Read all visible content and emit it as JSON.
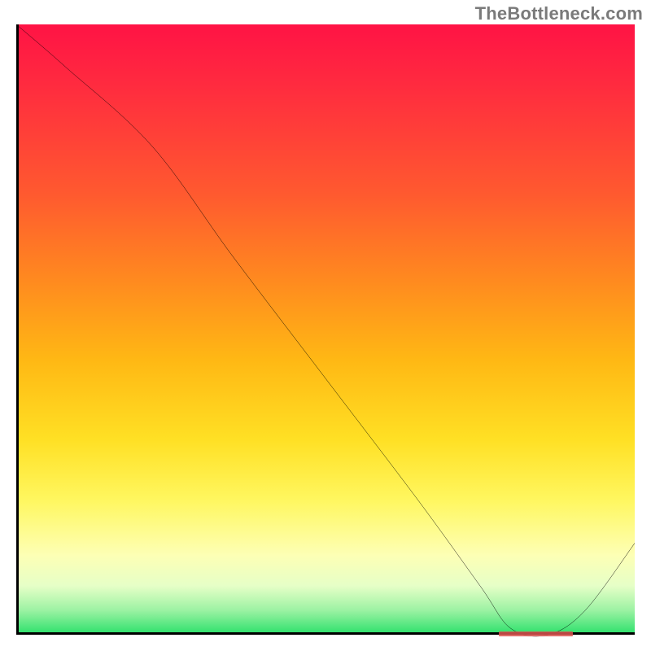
{
  "watermark": "TheBottleneck.com",
  "colors": {
    "watermark": "#7a7a7a",
    "curve": "#000000",
    "axis": "#000000",
    "flat_marker": "#d9534f"
  },
  "chart_data": {
    "type": "line",
    "title": "",
    "xlabel": "",
    "ylabel": "",
    "xlim": [
      0,
      100
    ],
    "ylim": [
      0,
      100
    ],
    "grid": false,
    "legend": false,
    "background_gradient": {
      "direction": "vertical",
      "stops": [
        {
          "pos": 0,
          "color": "#ff1345"
        },
        {
          "pos": 10,
          "color": "#ff2b3f"
        },
        {
          "pos": 28,
          "color": "#ff5a2f"
        },
        {
          "pos": 42,
          "color": "#ff8a1f"
        },
        {
          "pos": 55,
          "color": "#ffb814"
        },
        {
          "pos": 68,
          "color": "#ffe024"
        },
        {
          "pos": 78,
          "color": "#fff760"
        },
        {
          "pos": 87,
          "color": "#fdffb5"
        },
        {
          "pos": 92,
          "color": "#e6ffc7"
        },
        {
          "pos": 96,
          "color": "#9cf2a3"
        },
        {
          "pos": 100,
          "color": "#29e06a"
        }
      ]
    },
    "series": [
      {
        "name": "curve",
        "x": [
          0,
          8,
          22,
          35,
          50,
          65,
          75,
          80,
          86,
          92,
          100
        ],
        "y": [
          100,
          93,
          80,
          62,
          42,
          22,
          8,
          1,
          0,
          4,
          15
        ]
      }
    ],
    "flat_region": {
      "x_start": 78,
      "x_end": 90,
      "y": 0
    }
  }
}
